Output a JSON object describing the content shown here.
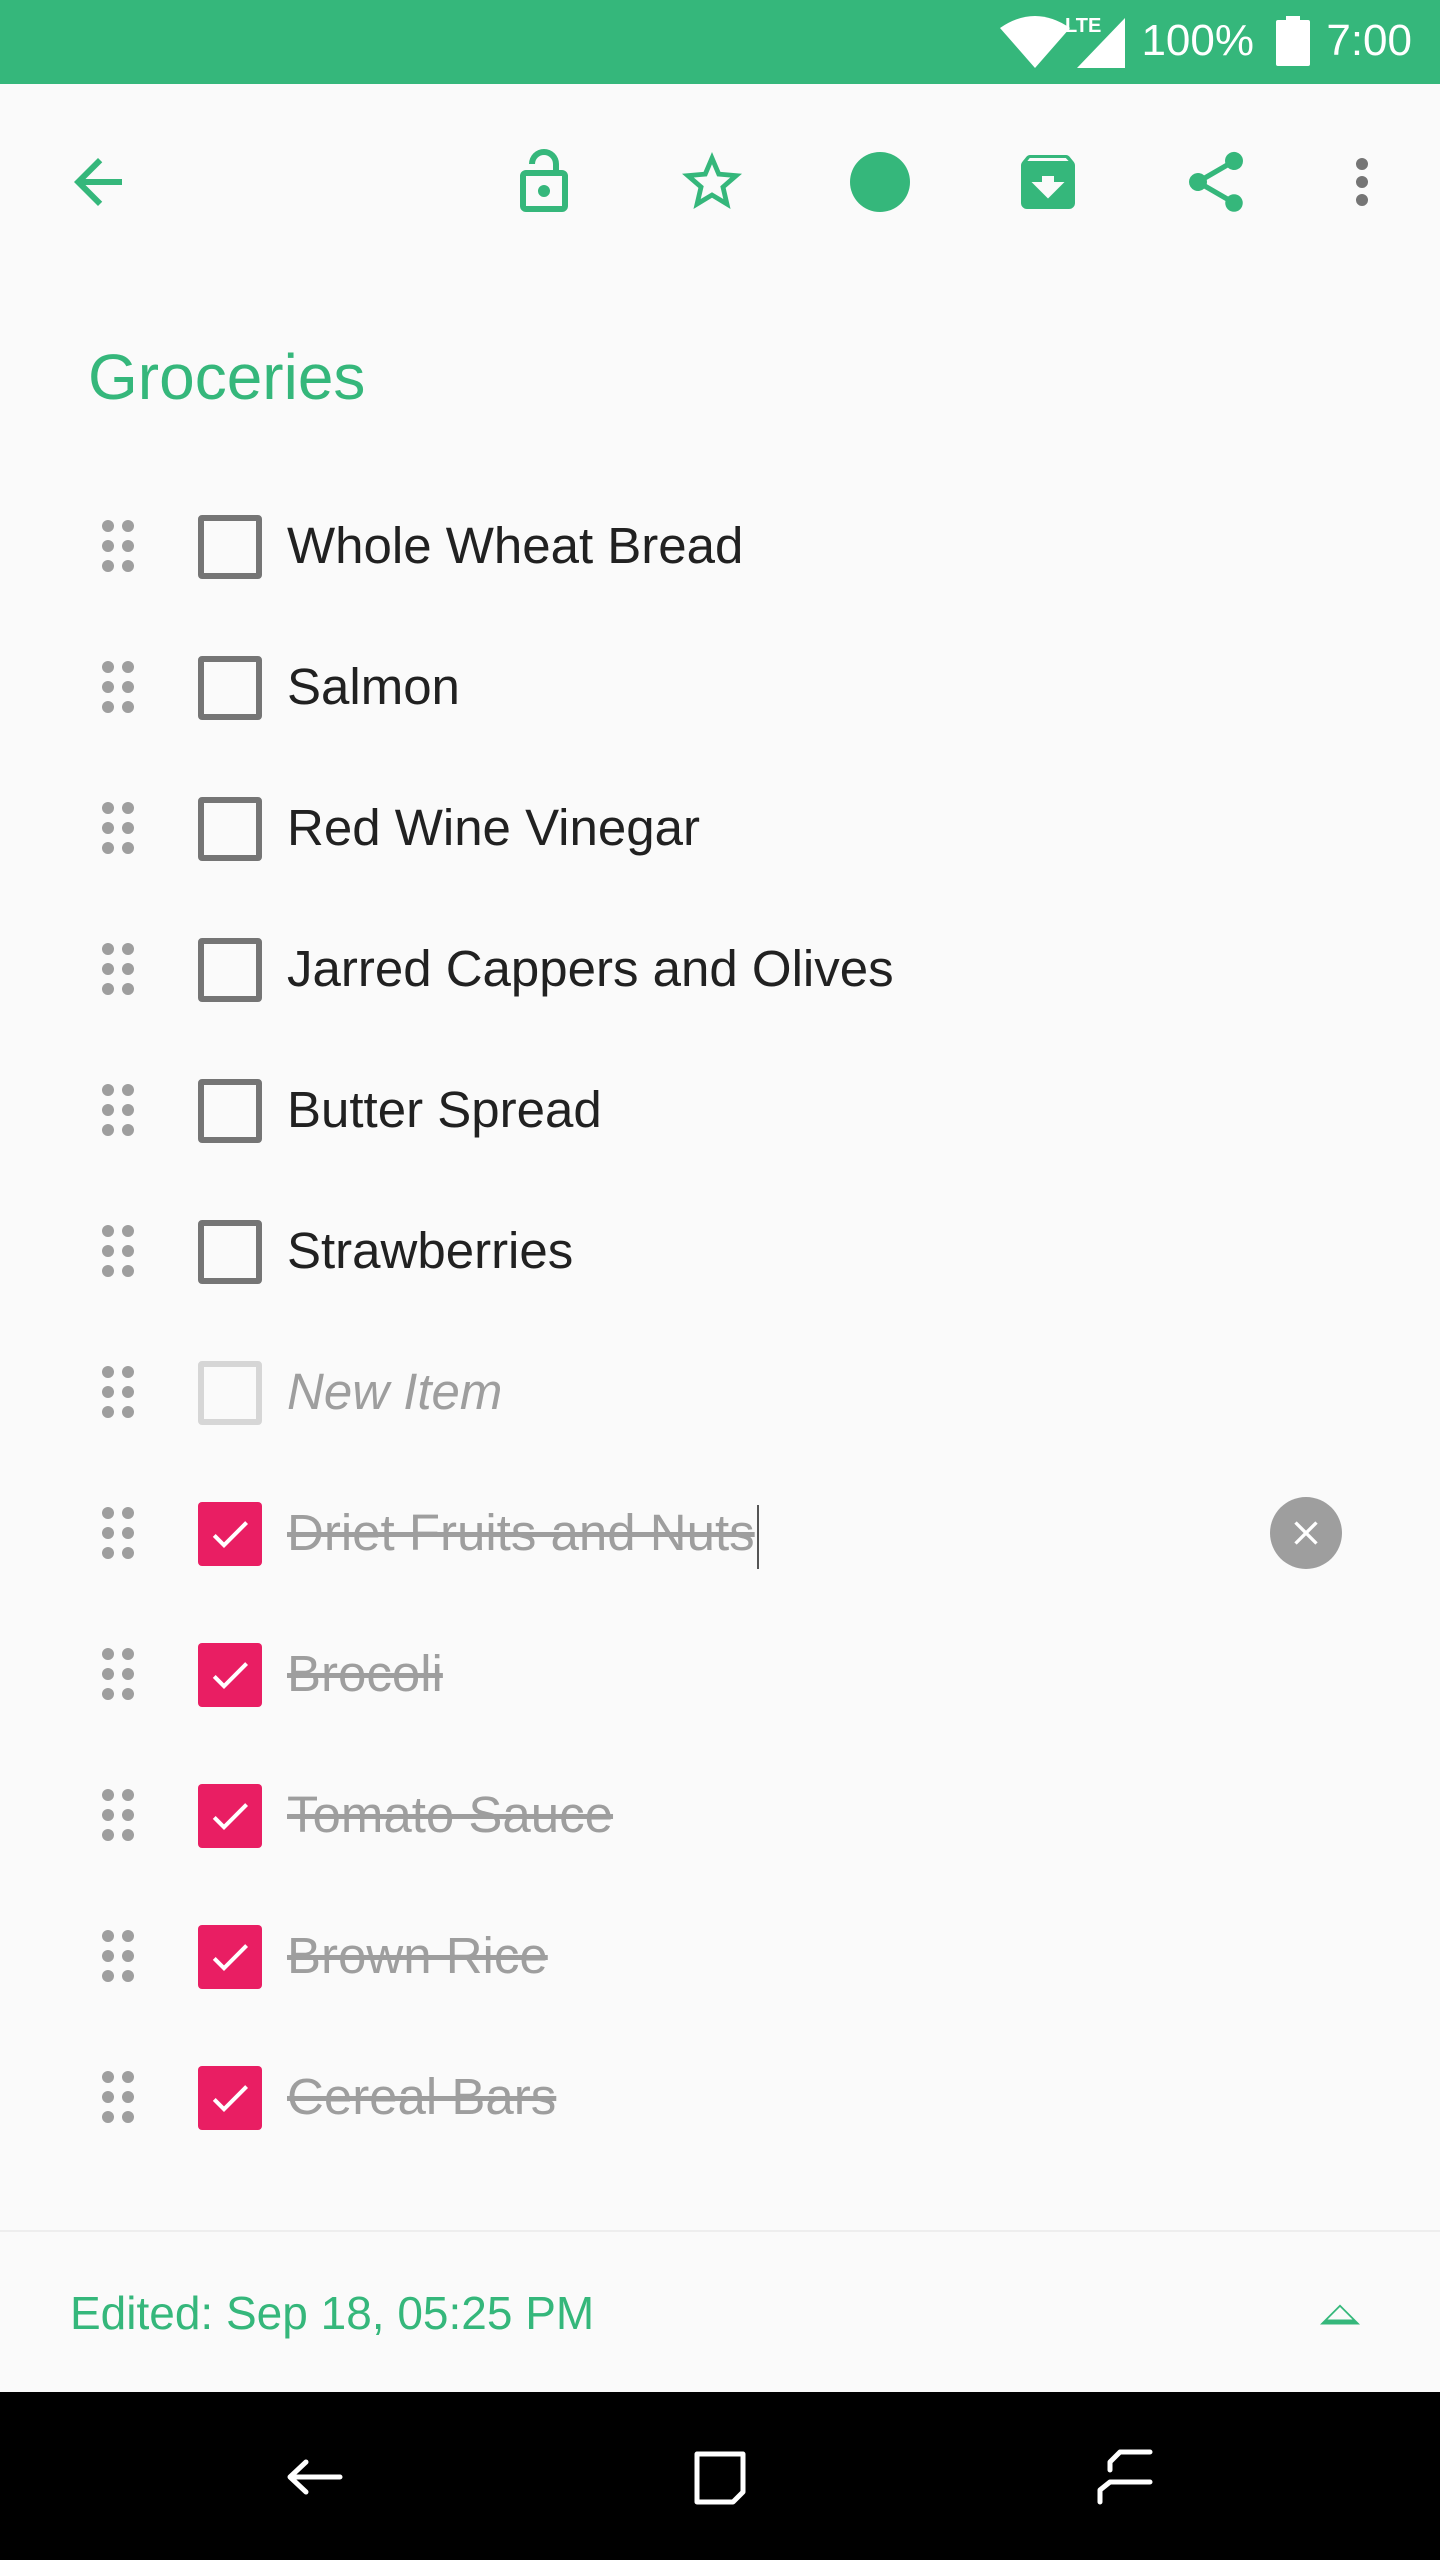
{
  "status_bar": {
    "battery_percent": "100%",
    "time": "7:00",
    "network": "LTE",
    "icons": [
      "wifi-icon",
      "lte-signal-icon",
      "battery-icon"
    ]
  },
  "toolbar": {
    "icons": [
      "back-arrow-icon",
      "lock-icon",
      "star-icon",
      "color-circle-icon",
      "archive-icon",
      "share-icon",
      "more-vert-icon"
    ],
    "accent_color": "#35b77b"
  },
  "note": {
    "title": "Groceries",
    "items": [
      {
        "text": "Whole Wheat Bread",
        "checked": false
      },
      {
        "text": "Salmon",
        "checked": false
      },
      {
        "text": "Red Wine Vinegar",
        "checked": false
      },
      {
        "text": "Jarred Cappers and Olives",
        "checked": false
      },
      {
        "text": "Butter Spread",
        "checked": false
      },
      {
        "text": "Strawberries",
        "checked": false
      }
    ],
    "new_item_placeholder": "New Item",
    "checked_items": [
      {
        "text": "Driet Fruits and Nuts",
        "checked": true
      },
      {
        "text": "Brocoli",
        "checked": true
      },
      {
        "text": "Tomato Sauce",
        "checked": true
      },
      {
        "text": "Brown Rice",
        "checked": true
      },
      {
        "text": "Cereal Bars",
        "checked": true
      }
    ],
    "checked_color": "#e91e63"
  },
  "footer": {
    "edited_label": "Edited: Sep 18, 05:25 PM"
  },
  "nav_bar": {
    "icons": [
      "nav-back-icon",
      "nav-home-icon",
      "nav-recents-icon"
    ]
  }
}
